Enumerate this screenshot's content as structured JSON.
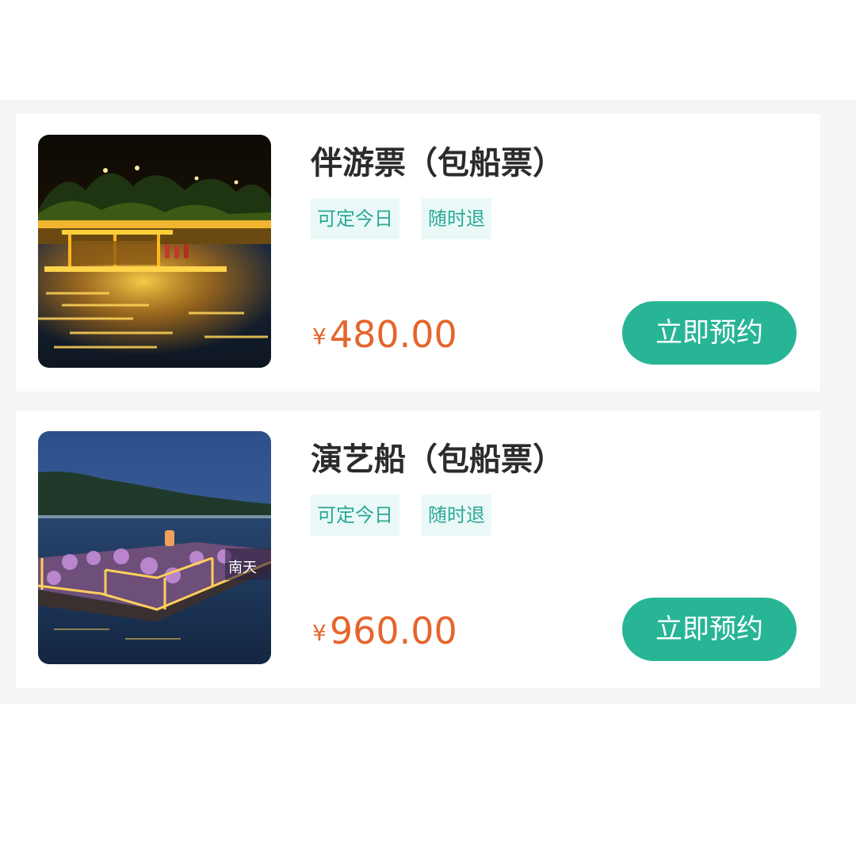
{
  "tickets": [
    {
      "title": "伴游票（包船票）",
      "tags": [
        "可定今日",
        "随时退"
      ],
      "currency": "¥",
      "price": "480.00",
      "button_label": "立即预约"
    },
    {
      "title": "演艺船（包船票）",
      "tags": [
        "可定今日",
        "随时退"
      ],
      "currency": "¥",
      "price": "960.00",
      "button_label": "立即预约"
    }
  ],
  "colors": {
    "accent": "#27b596",
    "price": "#e5652c",
    "tag_text": "#2aa897",
    "tag_bg": "#eaf9f7"
  }
}
